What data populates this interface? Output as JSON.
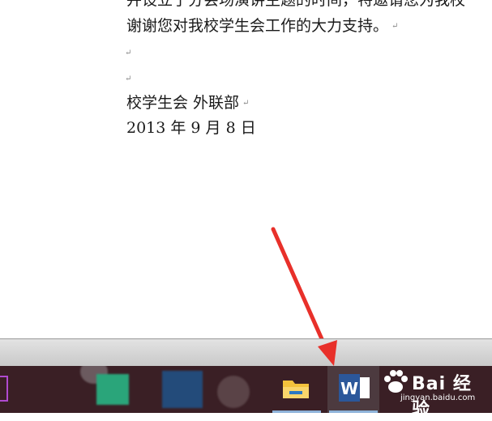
{
  "document": {
    "lines": [
      "并设立了分会场演讲主题的时间，特邀请您为我校",
      "谢谢您对我校学生会工作的大力支持。",
      "",
      "",
      "校学生会  外联部",
      "2013 年 9 月 8 日"
    ],
    "paragraph_mark": "↵"
  },
  "taskbar": {
    "apps": [
      "app-1",
      "app-2",
      "app-3",
      "app-4",
      "file-explorer",
      "word"
    ],
    "word_icon_letter": "W"
  },
  "watermark": {
    "title": "Bai 经验",
    "url": "jingyan.baidu.com"
  },
  "colors": {
    "arrow": "#e8302a",
    "taskbar": "#3a1f25",
    "word_blue": "#2b579a",
    "folder_yellow": "#f3c23c"
  }
}
